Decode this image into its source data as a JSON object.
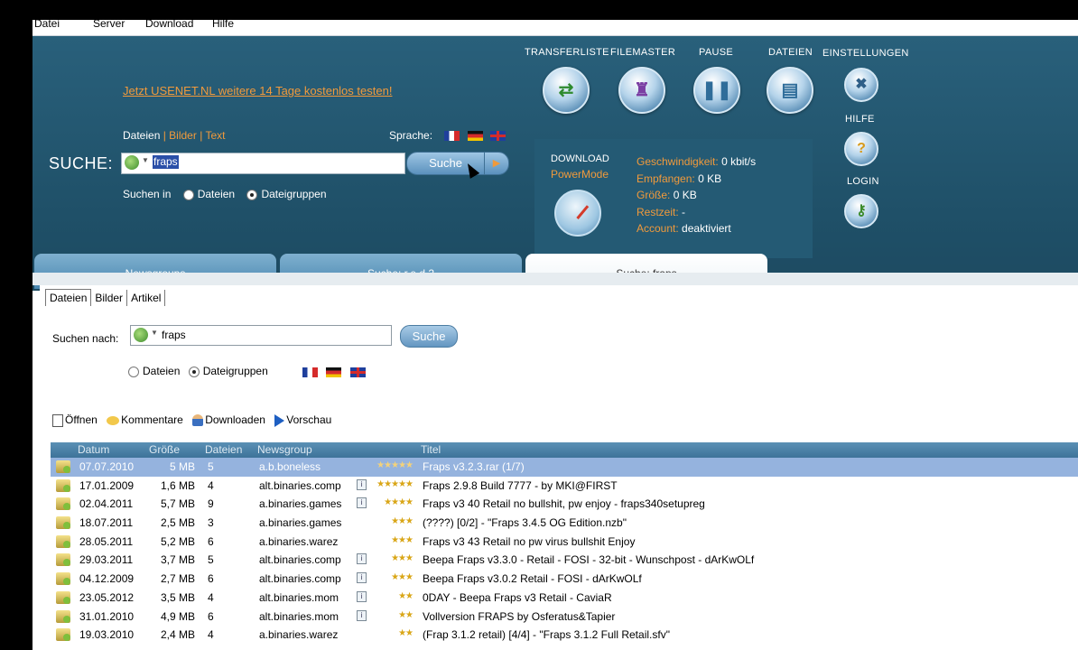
{
  "menu": [
    "Datei",
    "Server",
    "Download",
    "Hilfe"
  ],
  "promo": "Jetzt USENET.NL weitere 14 Tage kostenlos testen!",
  "type_links": {
    "dateien": "Dateien",
    "sep1": " | ",
    "bilder": "Bilder",
    "sep2": " | ",
    "text": "Text"
  },
  "sprache_label": "Sprache:",
  "search": {
    "label": "SUCHE:",
    "value": "fraps",
    "button": "Suche",
    "suchen_in": "Suchen in",
    "opt_dateien": "Dateien",
    "opt_dateigruppen": "Dateigruppen"
  },
  "toolbar": {
    "transferliste": "TRANSFERLISTE",
    "filemaster": "FILEMASTER",
    "pause": "PAUSE",
    "dateien": "DATEIEN",
    "einstellungen": "EINSTELLUNGEN",
    "hilfe": "HILFE",
    "login": "LOGIN"
  },
  "download": {
    "title": "DOWNLOAD",
    "powermode": "PowerMode",
    "stats": [
      {
        "key": "Geschwindigkeit:",
        "value": "0 kbit/s"
      },
      {
        "key": "Empfangen:",
        "value": "0 KB"
      },
      {
        "key": "Größe:",
        "value": "0 KB"
      },
      {
        "key": "Restzeit:",
        "value": "-"
      },
      {
        "key": "Account:",
        "value": "deaktiviert"
      }
    ]
  },
  "tabs": [
    "Newsgroups",
    "Suche: r.e.d 2",
    "Suche: fraps"
  ],
  "subtabs": [
    "Dateien",
    "Bilder",
    "Artikel"
  ],
  "search2": {
    "label": "Suchen nach:",
    "value": "fraps",
    "button": "Suche",
    "opt_dateien": "Dateien",
    "opt_dateigruppen": "Dateigruppen"
  },
  "actions": [
    "Öffnen",
    "Kommentare",
    "Downloaden",
    "Vorschau"
  ],
  "columns": [
    "Datum",
    "Größe",
    "Dateien",
    "Newsgroup",
    "Titel"
  ],
  "rows": [
    {
      "datum": "07.07.2010",
      "groesse": "5 MB",
      "dateien": "5",
      "newsgroup": "a.b.boneless",
      "info": false,
      "stars": "★★★★★",
      "titel": "Fraps v3.2.3.rar (1/7)",
      "selected": true
    },
    {
      "datum": "17.01.2009",
      "groesse": "1,6 MB",
      "dateien": "4",
      "newsgroup": "alt.binaries.comp",
      "info": true,
      "stars": "★★★★★",
      "titel": "Fraps 2.9.8 Build 7777 - by MKI@FIRST",
      "selected": false
    },
    {
      "datum": "02.04.2011",
      "groesse": "5,7 MB",
      "dateien": "9",
      "newsgroup": "a.binaries.games",
      "info": true,
      "stars": "★★★★",
      "titel": "Fraps v3 40 Retail no bullshit, pw enjoy - fraps340setupreg",
      "selected": false
    },
    {
      "datum": "18.07.2011",
      "groesse": "2,5 MB",
      "dateien": "3",
      "newsgroup": "a.binaries.games",
      "info": false,
      "stars": "★★★",
      "titel": "(????) [0/2] - \"Fraps 3.4.5 OG Edition.nzb\"",
      "selected": false
    },
    {
      "datum": "28.05.2011",
      "groesse": "5,2 MB",
      "dateien": "6",
      "newsgroup": "a.binaries.warez",
      "info": false,
      "stars": "★★★",
      "titel": "Fraps v3 43 Retail no pw virus bullshit Enjoy",
      "selected": false
    },
    {
      "datum": "29.03.2011",
      "groesse": "3,7 MB",
      "dateien": "5",
      "newsgroup": "alt.binaries.comp",
      "info": true,
      "stars": "★★★",
      "titel": "Beepa Fraps v3.3.0 - Retail - FOSI - 32-bit - Wunschpost - dArKwOLf",
      "selected": false
    },
    {
      "datum": "04.12.2009",
      "groesse": "2,7 MB",
      "dateien": "6",
      "newsgroup": "alt.binaries.comp",
      "info": true,
      "stars": "★★★",
      "titel": "Beepa Fraps v3.0.2 Retail - FOSI - dArKwOLf",
      "selected": false
    },
    {
      "datum": "23.05.2012",
      "groesse": "3,5 MB",
      "dateien": "4",
      "newsgroup": "alt.binaries.mom",
      "info": true,
      "stars": "★★",
      "titel": "0DAY - Beepa Fraps v3 Retail - CaviaR",
      "selected": false
    },
    {
      "datum": "31.01.2010",
      "groesse": "4,9 MB",
      "dateien": "6",
      "newsgroup": "alt.binaries.mom",
      "info": true,
      "stars": "★★",
      "titel": "Vollversion FRAPS by Osferatus&Tapier",
      "selected": false
    },
    {
      "datum": "19.03.2010",
      "groesse": "2,4 MB",
      "dateien": "4",
      "newsgroup": "a.binaries.warez",
      "info": false,
      "stars": "★★",
      "titel": "(Frap 3.1.2 retail) [4/4] - \"Fraps 3.1.2 Full Retail.sfv\"",
      "selected": false
    }
  ]
}
